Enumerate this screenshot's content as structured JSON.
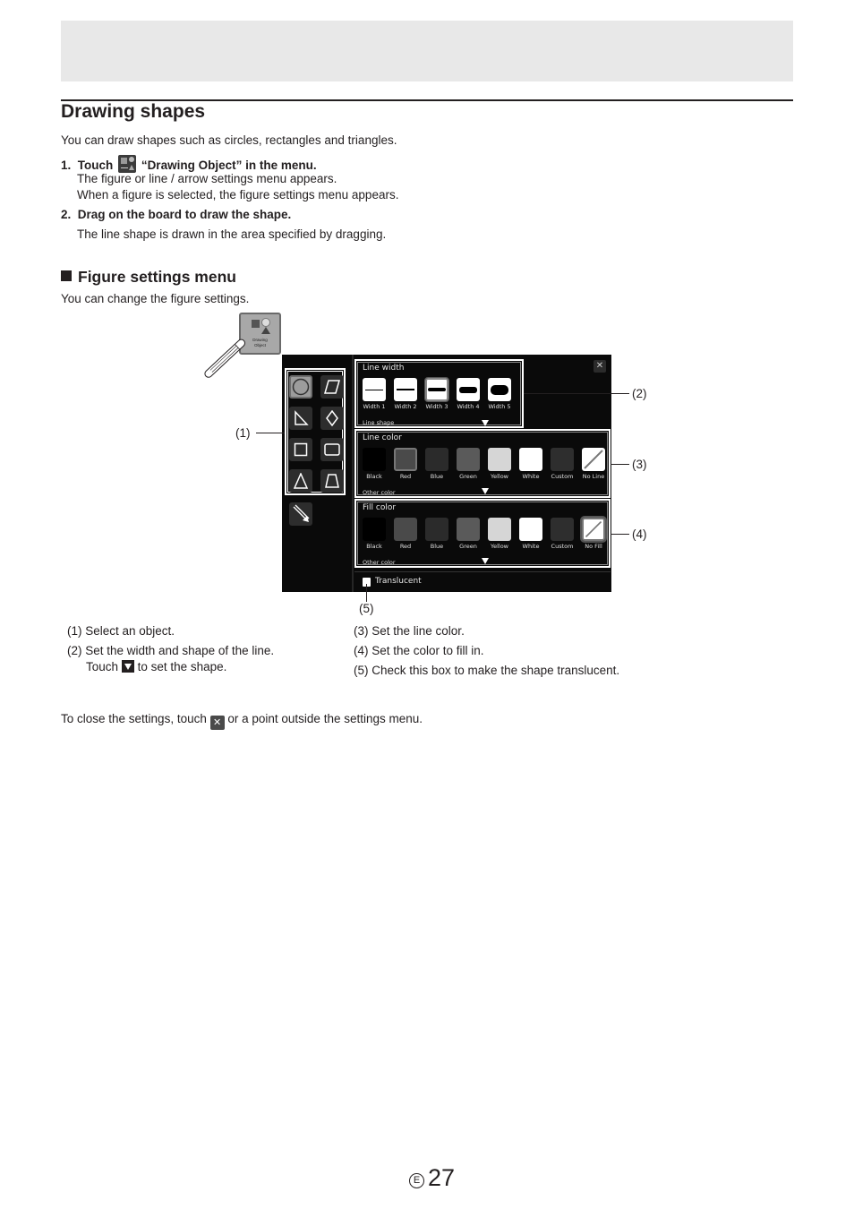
{
  "page": {
    "title": "Drawing shapes",
    "intro": "You can draw shapes such as circles, rectangles and triangles.",
    "steps": [
      {
        "num": "1.",
        "text_before": "Touch",
        "icon": "drawing-object-icon",
        "text_after": "“Drawing Object” in the menu.",
        "details": [
          "The figure or line / arrow settings menu appears.",
          "When a figure is selected, the figure settings menu appears."
        ]
      },
      {
        "num": "2.",
        "text": "Drag on the board to draw the shape.",
        "details": [
          "The line shape is drawn in the area specified by dragging."
        ]
      }
    ],
    "section_title": "Figure settings menu",
    "section_intro": "You can change the figure settings.",
    "page_number": "27",
    "page_region": "E"
  },
  "figure": {
    "menu_button": {
      "label_line1": "Drawing",
      "label_line2": "Object"
    },
    "shapes": [
      "circle",
      "parallelogram",
      "right-triangle",
      "diamond",
      "square",
      "rectangle",
      "triangle",
      "trapezoid",
      "line-arrow"
    ],
    "selected_shape": "circle",
    "line_width": {
      "title": "Line width",
      "options": [
        "Width 1",
        "Width 2",
        "Width 3",
        "Width 4",
        "Width 5"
      ],
      "selected": "Width 3",
      "sub_label": "Line shape"
    },
    "line_color": {
      "title": "Line color",
      "options": [
        {
          "label": "Black",
          "color": "#000000"
        },
        {
          "label": "Red",
          "color": "#4a4a4a"
        },
        {
          "label": "Blue",
          "color": "#2b2b2b"
        },
        {
          "label": "Green",
          "color": "#5a5a5a"
        },
        {
          "label": "Yellow",
          "color": "#d6d6d6"
        },
        {
          "label": "White",
          "color": "#ffffff"
        },
        {
          "label": "Custom",
          "color": "#2e2e2e"
        },
        {
          "label": "No Line",
          "color": "none"
        }
      ],
      "selected": "Red",
      "sub_label": "Other color"
    },
    "fill_color": {
      "title": "Fill color",
      "options": [
        {
          "label": "Black",
          "color": "#000000"
        },
        {
          "label": "Red",
          "color": "#4a4a4a"
        },
        {
          "label": "Blue",
          "color": "#2b2b2b"
        },
        {
          "label": "Green",
          "color": "#5a5a5a"
        },
        {
          "label": "Yellow",
          "color": "#d6d6d6"
        },
        {
          "label": "White",
          "color": "#ffffff"
        },
        {
          "label": "Custom",
          "color": "#2e2e2e"
        },
        {
          "label": "No Fill",
          "color": "none"
        }
      ],
      "selected": "No Fill",
      "sub_label": "Other color"
    },
    "translucent": {
      "label": "Translucent",
      "checked": false
    },
    "close_icon": "close-icon",
    "callouts": [
      "(1)",
      "(2)",
      "(3)",
      "(4)",
      "(5)"
    ]
  },
  "legend": {
    "left": [
      "(1) Select an object.",
      "(2) Set the width and shape of the line."
    ],
    "left_touch_before": "Touch",
    "left_touch_after": "to set the shape.",
    "right": [
      "(3) Set the line color.",
      "(4) Set the color to fill in.",
      "(5) Check this box to make the shape translucent."
    ]
  },
  "footer_note": {
    "before": "To close the settings, touch",
    "after": "or a point outside the settings menu."
  }
}
